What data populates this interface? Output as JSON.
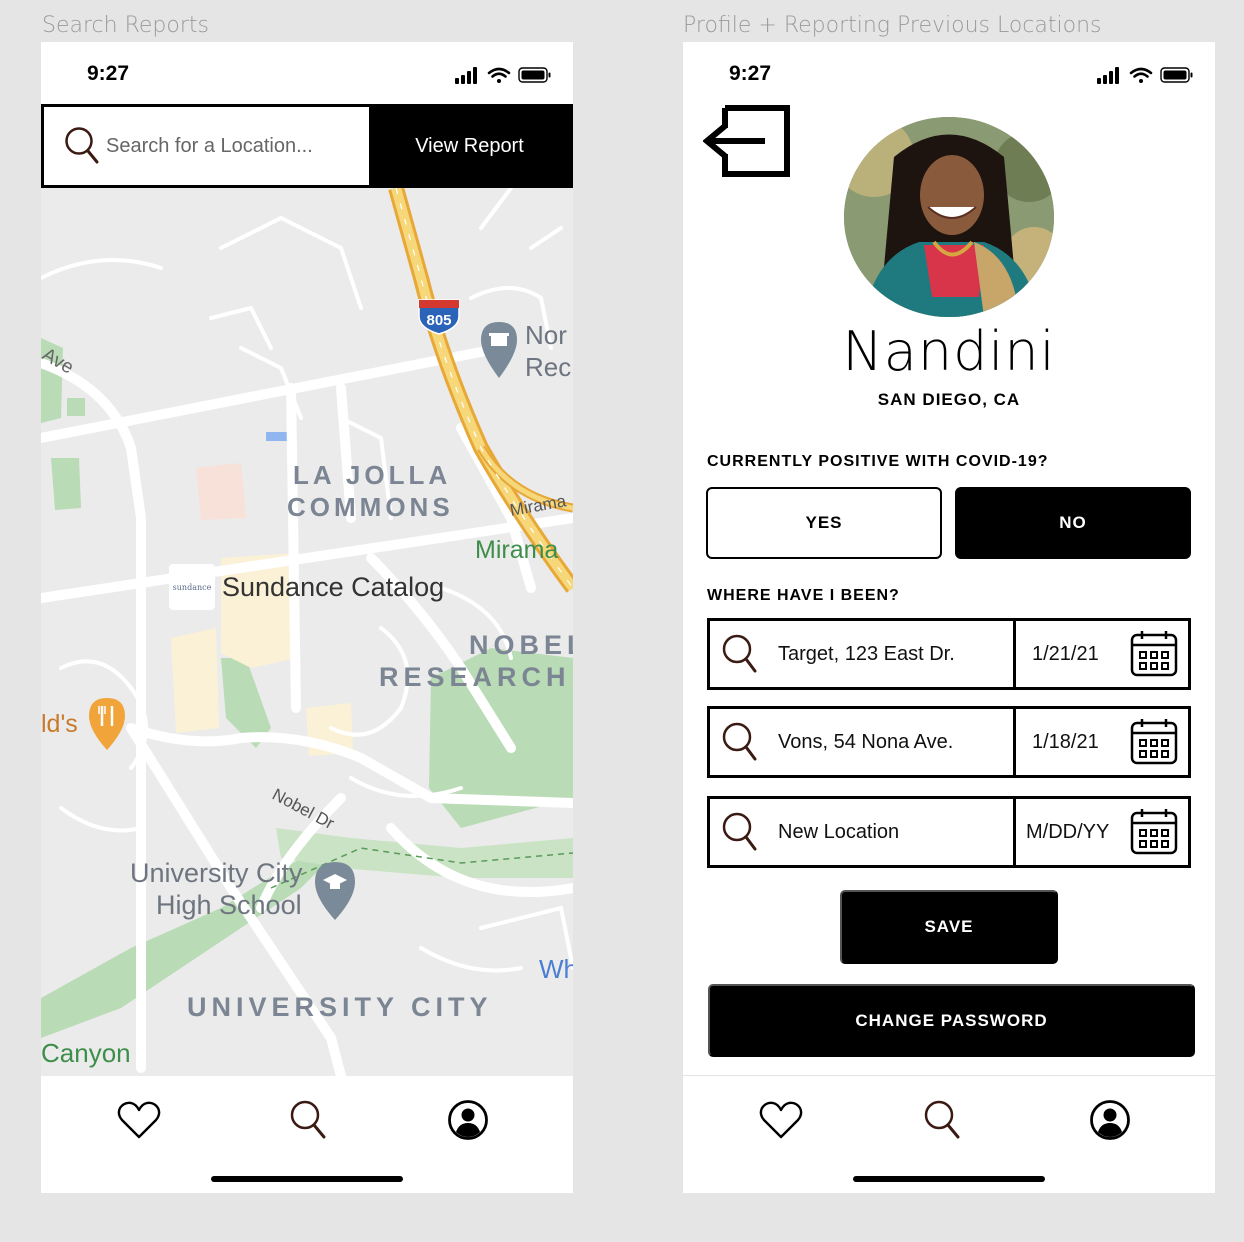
{
  "labels": {
    "left_frame": "Search Reports",
    "right_frame": "Profile + Reporting Previous Locations"
  },
  "status": {
    "time": "9:27"
  },
  "search": {
    "placeholder": "Search for a Location...",
    "button": "View Report"
  },
  "map": {
    "labels": [
      "Ave",
      "805",
      "Nor",
      "Rec",
      "LA JOLLA",
      "COMMONS",
      "Mirama",
      "Mirama",
      "sundance",
      "Sundance Catalog",
      "NOBEL",
      "RESEARCH",
      "ld's",
      "Nobel Dr",
      "University City",
      "High School",
      "Wh",
      "UNIVERSITY CITY",
      "Canyon"
    ]
  },
  "tabs": [
    "heart-icon",
    "search-icon",
    "profile-icon"
  ],
  "profile": {
    "name": "Nandini",
    "location": "SAN DIEGO, CA",
    "covid_question": "CURRENTLY POSITIVE WITH COVID-19?",
    "yes_label": "YES",
    "no_label": "NO",
    "selected": "NO",
    "where_label": "WHERE HAVE I BEEN?",
    "visits": [
      {
        "place": "Target, 123 East Dr.",
        "date": "1/21/21"
      },
      {
        "place": "Vons, 54 Nona Ave.",
        "date": "1/18/21"
      },
      {
        "place": "New Location",
        "date": "M/DD/YY"
      }
    ],
    "save_label": "SAVE",
    "change_password_label": "CHANGE PASSWORD"
  },
  "colors": {
    "accent": "#000000",
    "icon_brown": "#3a1a12",
    "map_bg": "#ebebeb",
    "park_green": "#b9dbb5",
    "highway": "#f2c14e"
  }
}
